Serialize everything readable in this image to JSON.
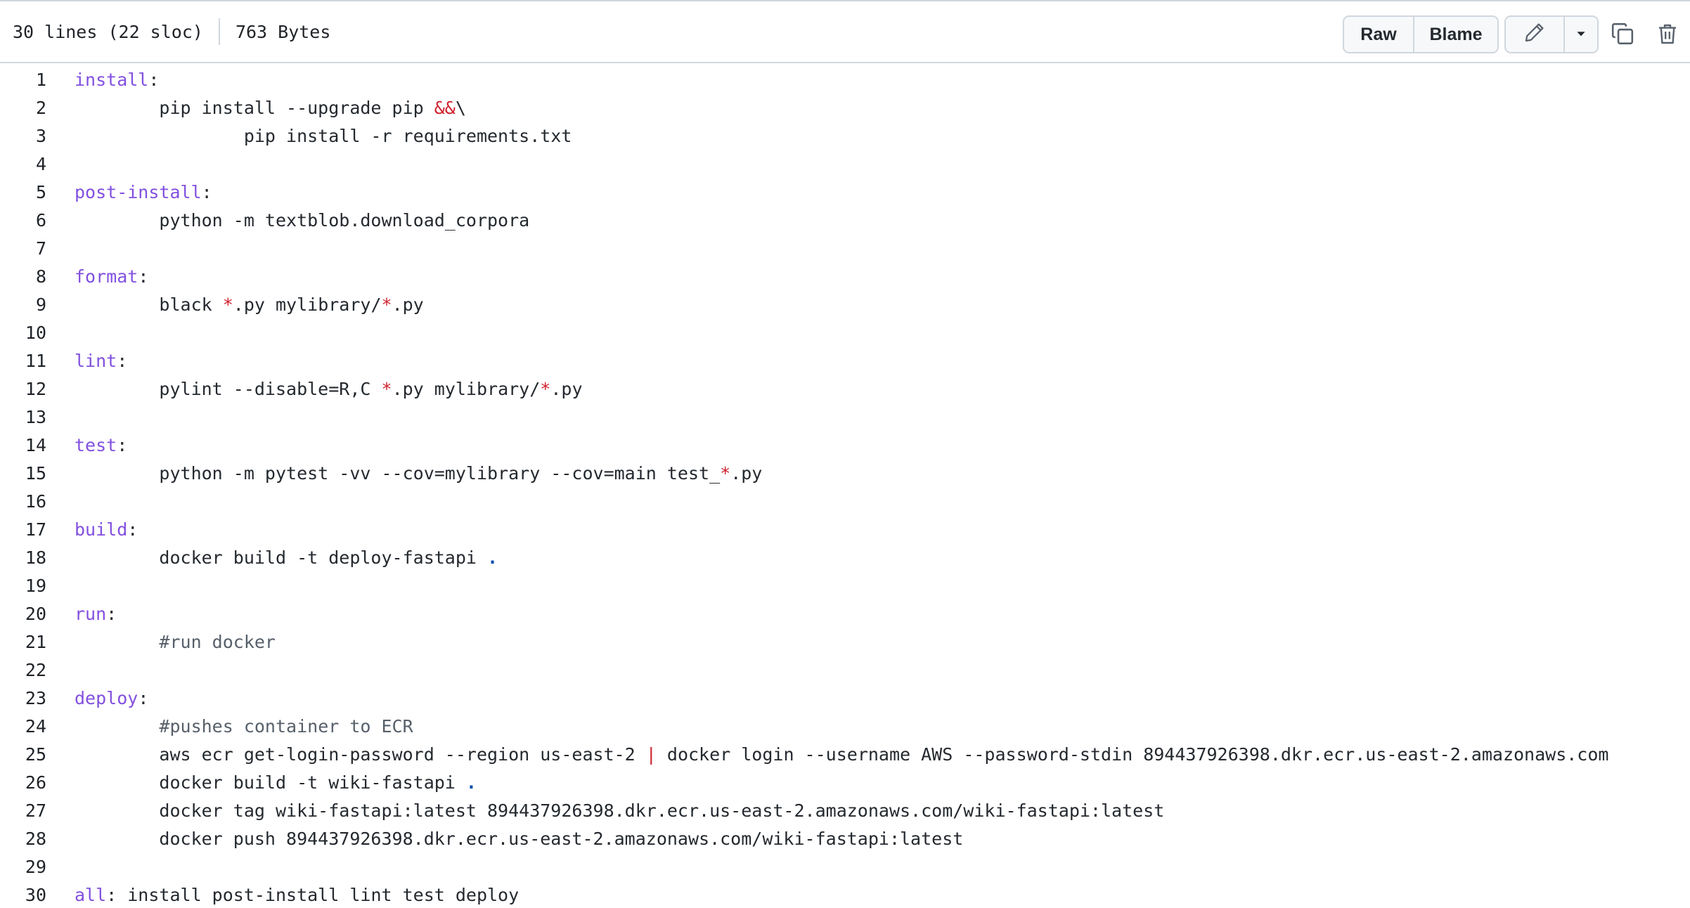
{
  "header": {
    "lines_info": "30 lines (22 sloc)",
    "size_info": "763 Bytes",
    "raw_label": "Raw",
    "blame_label": "Blame",
    "edit_icon": "pencil-icon",
    "dropdown_icon": "triangle-down-icon",
    "copy_icon": "copy-icon",
    "delete_icon": "trash-icon"
  },
  "code": {
    "lines": [
      {
        "n": "1",
        "segs": [
          {
            "t": "install",
            "c": "k"
          },
          {
            "t": ":"
          }
        ]
      },
      {
        "n": "2",
        "segs": [
          {
            "t": "\tpip install --upgrade pip "
          },
          {
            "t": "&&",
            "c": "o"
          },
          {
            "t": "\\"
          }
        ]
      },
      {
        "n": "3",
        "segs": [
          {
            "t": "\t\tpip install -r requirements.txt"
          }
        ]
      },
      {
        "n": "4",
        "segs": []
      },
      {
        "n": "5",
        "segs": [
          {
            "t": "post-install",
            "c": "k"
          },
          {
            "t": ":"
          }
        ]
      },
      {
        "n": "6",
        "segs": [
          {
            "t": "\tpython -m textblob.download_corpora"
          }
        ]
      },
      {
        "n": "7",
        "segs": []
      },
      {
        "n": "8",
        "segs": [
          {
            "t": "format",
            "c": "k"
          },
          {
            "t": ":"
          }
        ]
      },
      {
        "n": "9",
        "segs": [
          {
            "t": "\tblack "
          },
          {
            "t": "*",
            "c": "o"
          },
          {
            "t": ".py mylibrary/"
          },
          {
            "t": "*",
            "c": "o"
          },
          {
            "t": ".py"
          }
        ]
      },
      {
        "n": "10",
        "segs": []
      },
      {
        "n": "11",
        "segs": [
          {
            "t": "lint",
            "c": "k"
          },
          {
            "t": ":"
          }
        ]
      },
      {
        "n": "12",
        "segs": [
          {
            "t": "\tpylint --disable=R,C "
          },
          {
            "t": "*",
            "c": "o"
          },
          {
            "t": ".py mylibrary/"
          },
          {
            "t": "*",
            "c": "o"
          },
          {
            "t": ".py"
          }
        ]
      },
      {
        "n": "13",
        "segs": []
      },
      {
        "n": "14",
        "segs": [
          {
            "t": "test",
            "c": "k"
          },
          {
            "t": ":"
          }
        ]
      },
      {
        "n": "15",
        "segs": [
          {
            "t": "\tpython -m pytest -vv --cov=mylibrary --cov=main test_"
          },
          {
            "t": "*",
            "c": "o"
          },
          {
            "t": ".py"
          }
        ]
      },
      {
        "n": "16",
        "segs": []
      },
      {
        "n": "17",
        "segs": [
          {
            "t": "build",
            "c": "k"
          },
          {
            "t": ":"
          }
        ]
      },
      {
        "n": "18",
        "segs": [
          {
            "t": "\tdocker build -t deploy-fastapi "
          },
          {
            "t": ".",
            "c": "dot"
          }
        ]
      },
      {
        "n": "19",
        "segs": []
      },
      {
        "n": "20",
        "segs": [
          {
            "t": "run",
            "c": "k"
          },
          {
            "t": ":"
          }
        ]
      },
      {
        "n": "21",
        "segs": [
          {
            "t": "\t"
          },
          {
            "t": "#run docker",
            "c": "c"
          }
        ]
      },
      {
        "n": "22",
        "segs": []
      },
      {
        "n": "23",
        "segs": [
          {
            "t": "deploy",
            "c": "k"
          },
          {
            "t": ":"
          }
        ]
      },
      {
        "n": "24",
        "segs": [
          {
            "t": "\t"
          },
          {
            "t": "#pushes container to ECR",
            "c": "c"
          }
        ]
      },
      {
        "n": "25",
        "segs": [
          {
            "t": "\taws ecr get-login-password --region us-east-2 "
          },
          {
            "t": "|",
            "c": "o"
          },
          {
            "t": " docker login --username AWS --password-stdin 894437926398.dkr.ecr.us-east-2.amazonaws.com"
          }
        ]
      },
      {
        "n": "26",
        "segs": [
          {
            "t": "\tdocker build -t wiki-fastapi "
          },
          {
            "t": ".",
            "c": "dot"
          }
        ]
      },
      {
        "n": "27",
        "segs": [
          {
            "t": "\tdocker tag wiki-fastapi:latest 894437926398.dkr.ecr.us-east-2.amazonaws.com/wiki-fastapi:latest"
          }
        ]
      },
      {
        "n": "28",
        "segs": [
          {
            "t": "\tdocker push 894437926398.dkr.ecr.us-east-2.amazonaws.com/wiki-fastapi:latest"
          }
        ]
      },
      {
        "n": "29",
        "segs": []
      },
      {
        "n": "30",
        "segs": [
          {
            "t": "all",
            "c": "k"
          },
          {
            "t": ": install post-install lint test deploy"
          }
        ]
      }
    ]
  },
  "colors": {
    "keyword": "#8250df",
    "operator": "#cf222e",
    "comment": "#57606a",
    "text": "#24292f",
    "border": "#d0d7de",
    "button_bg": "#f6f8fa"
  }
}
